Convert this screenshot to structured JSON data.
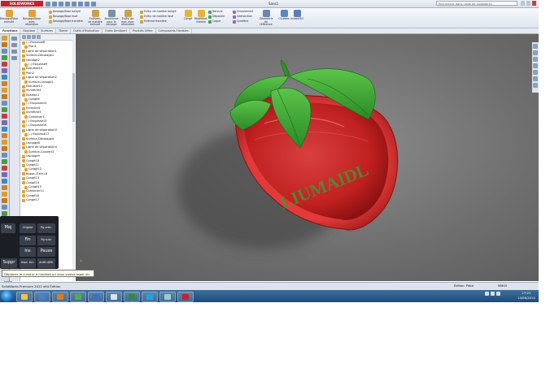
{
  "title_bar": {
    "app_logo": "SOLIDWORKS",
    "doc_title": "Sans1",
    "search_placeholder": "Rechercher dans l'aide de SolidWorks",
    "quick_access_icons": [
      "new-icon",
      "open-icon",
      "save-icon",
      "print-icon",
      "undo-icon",
      "select-icon",
      "rebuild-icon",
      "options-icon"
    ]
  },
  "ribbon": {
    "big_buttons": [
      {
        "label": "Bossage/Base extrudé",
        "icon": "extrude-icon",
        "color": "#e2a13a"
      },
      {
        "label": "Bossage/Base avec révolution",
        "icon": "revolve-icon",
        "color": "#e2a13a"
      },
      {
        "label": "Enlèvem. de matière extrudé",
        "icon": "cut-extrude-icon",
        "color": "#c9a34a"
      },
      {
        "label": "Assistance pour le perçage",
        "icon": "hole-wizard-icon",
        "color": "#7a8fa8"
      },
      {
        "label": "Enlèv. de mat. avec révolution",
        "icon": "cut-revolve-icon",
        "color": "#c9a34a"
      },
      {
        "label": "Congé",
        "icon": "fillet-icon",
        "color": "#e3b33a"
      },
      {
        "label": "Répétition linéaire",
        "icon": "linear-pattern-icon",
        "color": "#e3b33a"
      },
      {
        "label": "Géométrie de référence",
        "icon": "ref-geometry-icon",
        "color": "#6b86b0"
      },
      {
        "label": "Courbes",
        "icon": "curves-icon",
        "color": "#5f86bc"
      },
      {
        "label": "Instant3D",
        "icon": "instant3d-icon",
        "color": "#5b7fb5"
      }
    ],
    "small_buttons": [
      {
        "label": "Bossage/Base balayé",
        "color": "#e2a13a"
      },
      {
        "label": "Bossage/Base lissé",
        "color": "#e2a13a"
      },
      {
        "label": "Bossage/Base frontière",
        "color": "#e2a13a"
      },
      {
        "label": "Enlèv. de matière balayé",
        "color": "#c9a34a"
      },
      {
        "label": "Enlèv. de matière lissé",
        "color": "#c9a34a"
      },
      {
        "label": "Enlèvmt frontière",
        "color": "#c9a34a"
      },
      {
        "label": "Nervure",
        "color": "#48a05a"
      },
      {
        "label": "Dépouille",
        "color": "#48a05a"
      },
      {
        "label": "Coque",
        "color": "#48a05a"
      },
      {
        "label": "Enroulement",
        "color": "#8e6fb0"
      },
      {
        "label": "Intersection",
        "color": "#8e6fb0"
      },
      {
        "label": "Symétrie",
        "color": "#8e6fb0"
      }
    ]
  },
  "tabs": [
    "Fonctions",
    "Esquisse",
    "Surfaces",
    "Tôlerie",
    "Outils d'évaluation",
    "Outils DimXpert",
    "Produits Office",
    "Composants Flexibles"
  ],
  "active_tab": 0,
  "feature_tree": [
    "(-) Esquisse8",
    "Plan1",
    "Ligne de séparation1",
    "Surface-Décalage1",
    "Usinage2",
    "(-) Esquisse9",
    "Esquisse10",
    "Plan2",
    "Ligne de séparation2",
    "Surface-Lissage1",
    "Esquisse12",
    "Symétrie4",
    "Epaissir1",
    "Congé6",
    "(-) Esquisse14",
    "Enrouler4",
    "Symétrie4",
    "Combiner1",
    "(-) Esquisse13",
    "(-) Esquisse16",
    "Ligne de séparation3",
    "(-) Esquisse17",
    "Surface-Décalage4",
    "Usinage8",
    "Ligne de séparation4",
    "Surface-Couvert2",
    "Usinage9",
    "Congé10",
    "Congé11",
    "Congé12",
    "Bossa.-Extru.6",
    "Congé13",
    "Congé14",
    "Congé15",
    "Combiner11",
    "Congé16",
    "Congé17"
  ],
  "viewport": {
    "watermark": "LIUMAIDL",
    "model": "strawberry-dish",
    "body_color": "#cc2424",
    "leaf_color": "#3aa232"
  },
  "keyboard": {
    "keys": [
      "Maj",
      "Origine",
      "Pg préc.",
      "Fin",
      "Pg suiv.",
      "Ins",
      "Pause",
      "Suppr",
      "Impr. écr.",
      "Arrêt défil."
    ]
  },
  "tooltip": "Déplacez le curseur à l'endroit où vous voulez taper du texte.",
  "status_bar": {
    "left": "SolidWorks Premium 2012 x64 Édition",
    "mid": "Édition: Pièce",
    "right": "MMGS"
  },
  "taskbar": {
    "apps": [
      {
        "name": "explorer",
        "color": "#f2c14a"
      },
      {
        "name": "ie",
        "color": "#3a86d6"
      },
      {
        "name": "media",
        "color": "#e07a1e"
      },
      {
        "name": "chrome",
        "color": "#4caf50"
      },
      {
        "name": "messenger",
        "color": "#3b6fc8"
      },
      {
        "name": "tablet",
        "color": "#d8e4f0"
      },
      {
        "name": "excel",
        "color": "#2e8b3a"
      },
      {
        "name": "skype",
        "color": "#1ea5e0"
      },
      {
        "name": "tool",
        "color": "#9cc"
      },
      {
        "name": "solidworks",
        "color": "#c8202a"
      }
    ],
    "time": "17:21",
    "date": "14/06/2014"
  }
}
